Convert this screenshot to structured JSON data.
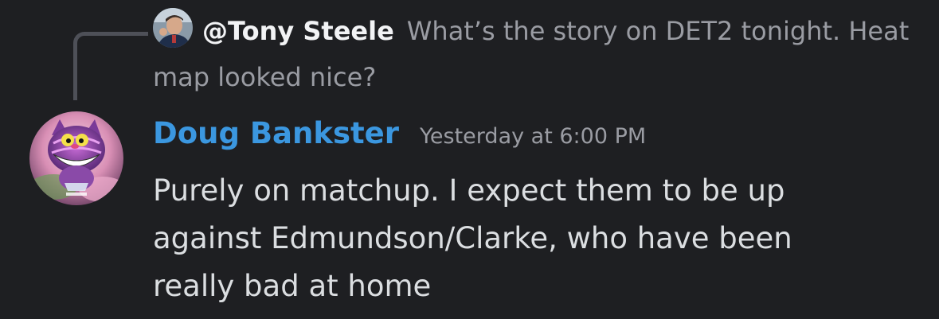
{
  "reply": {
    "author": "@Tony Steele",
    "text": "What’s the story on DET2 tonight. Heat map looked nice?"
  },
  "message": {
    "author": "Doug Bankster",
    "author_color": "#3b97e0",
    "timestamp": "Yesterday at 6:00 PM",
    "content": "Purely on matchup. I expect them to be up\nagainst Edmundson/Clarke, who have been\nreally bad at home"
  },
  "icons": {
    "reply_avatar": "user-avatar-photo",
    "author_avatar": "cheshire-cat-avatar"
  }
}
